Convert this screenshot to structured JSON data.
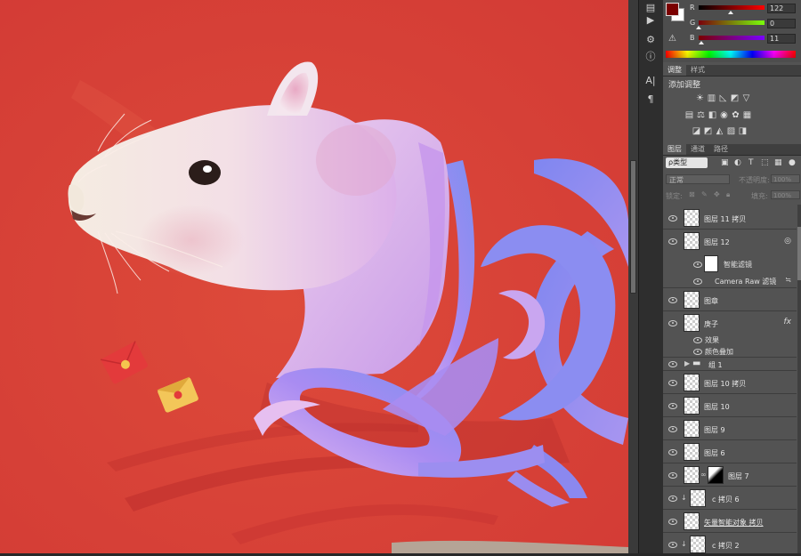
{
  "colors": {
    "foreground": "#7a0000",
    "background": "#ffffff",
    "canvas_red": "#d83b33"
  },
  "color_panel": {
    "channels": [
      {
        "label": "R",
        "value": "122",
        "fraction": 0.48
      },
      {
        "label": "G",
        "value": "0",
        "fraction": 0.0
      },
      {
        "label": "B",
        "value": "11",
        "fraction": 0.04
      }
    ]
  },
  "adjust_panel": {
    "tabs": [
      "调整",
      "样式"
    ],
    "title": "添加调整",
    "icons_row1": [
      "brightness-icon",
      "levels-icon",
      "curves-icon",
      "exposure-icon",
      "vibrance-icon"
    ],
    "icons_row2": [
      "hue-saturation-icon",
      "color-balance-icon",
      "black-white-icon",
      "photo-filter-icon",
      "channel-mixer-icon",
      "color-lookup-icon"
    ],
    "icons_row3": [
      "invert-icon",
      "posterize-icon",
      "threshold-icon",
      "gradient-map-icon",
      "selective-color-icon"
    ]
  },
  "layers_panel": {
    "tabs": [
      "图层",
      "通道",
      "路径"
    ],
    "filter_kind": "ρ类型",
    "blend_mode": "正常",
    "opacity_label": "不透明度:",
    "opacity_value": "100%",
    "lock_label": "锁定:",
    "fill_label": "填充:",
    "fill_value": "100%",
    "layers": [
      {
        "name": "图层 11 拷贝"
      },
      {
        "name": "图层 12"
      },
      {
        "name": "智能滤镜"
      },
      {
        "name": "Camera Raw 滤镜"
      },
      {
        "name": "图章"
      },
      {
        "name": "庚子"
      },
      {
        "name": "效果"
      },
      {
        "name": "颜色叠加"
      },
      {
        "name": "组 1"
      },
      {
        "name": "图层 10 拷贝"
      },
      {
        "name": "图层 10"
      },
      {
        "name": "图层 9"
      },
      {
        "name": "图层 6"
      },
      {
        "name": "图层 7"
      },
      {
        "name": "c 拷贝 6"
      },
      {
        "name": "矢量智能对象 拷贝"
      },
      {
        "name": "c 拷贝 2"
      }
    ]
  }
}
